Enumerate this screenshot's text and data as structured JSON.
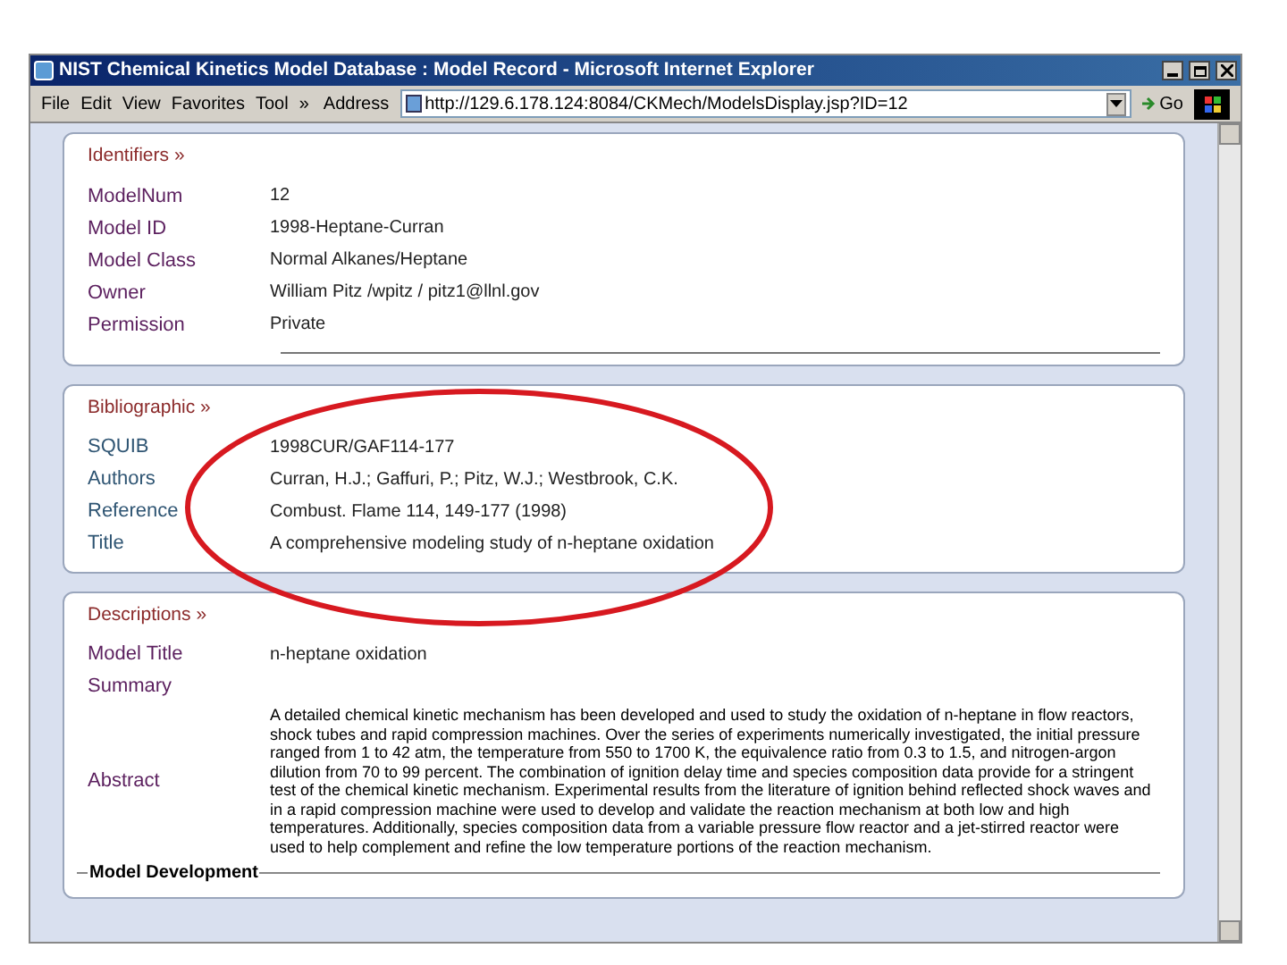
{
  "window": {
    "title": "NIST Chemical Kinetics Model Database : Model Record - Microsoft Internet Explorer"
  },
  "menu": [
    "File",
    "Edit",
    "View",
    "Favorites",
    "Tool",
    "»"
  ],
  "address": {
    "label": "Address",
    "value": "http://129.6.178.124:8084/CKMech/ModelsDisplay.jsp?ID=12"
  },
  "go_button": "Go",
  "sections": [
    {
      "heading": "Identifiers »",
      "kind": "identifiers",
      "rows": [
        {
          "kind": "field",
          "label": "ModelNum",
          "value": "12"
        },
        {
          "kind": "field",
          "label": "Model ID",
          "value": "1998-Heptane-Curran"
        },
        {
          "kind": "field",
          "label": "Model Class",
          "value": "Normal Alkanes/Heptane"
        },
        {
          "kind": "field",
          "label": "Owner",
          "value": "William Pitz /wpitz / pitz1@llnl.gov"
        },
        {
          "kind": "field",
          "label": "Permission",
          "value": "Private"
        }
      ]
    },
    {
      "heading": "Bibliographic »",
      "kind": "bibliographic",
      "rows": [
        {
          "kind": "field",
          "label": "SQUIB",
          "value": "1998CUR/GAF114-177"
        },
        {
          "kind": "field",
          "label": "Authors",
          "value": "Curran, H.J.; Gaffuri, P.; Pitz, W.J.; Westbrook, C.K."
        },
        {
          "kind": "field",
          "label": "Reference",
          "value": "Combust. Flame 114, 149-177 (1998)"
        },
        {
          "kind": "field",
          "label": "Title",
          "value": "A comprehensive modeling study of n-heptane oxidation"
        }
      ]
    },
    {
      "heading": "Descriptions »",
      "kind": "descriptions",
      "rows": [
        {
          "kind": "field",
          "label": "Model Title",
          "value": "n-heptane oxidation"
        },
        {
          "kind": "label",
          "label": "Summary"
        },
        {
          "kind": "paragraph",
          "label": "Abstract",
          "value": "A detailed chemical kinetic mechanism has been developed and used to study the oxidation of n-heptane in flow reactors, shock tubes and rapid compression machines. Over the series of experiments numerically investigated, the initial pressure ranged from 1 to 42 atm, the temperature from 550 to 1700 K, the equivalence ratio from 0.3 to 1.5, and nitrogen-argon dilution from 70 to 99 percent. The combination of ignition delay time and species composition data provide for a stringent test of the chemical kinetic mechanism. Experimental results from the literature of ignition behind reflected shock waves and in a rapid compression machine were used to develop and validate the reaction mechanism at both low and high temperatures. Additionally, species composition data from a variable pressure flow reactor and a jet-stirred reactor were used to help complement and refine the low temperature portions of the reaction mechanism."
        },
        {
          "kind": "legend",
          "label": "Model Development"
        }
      ]
    }
  ]
}
